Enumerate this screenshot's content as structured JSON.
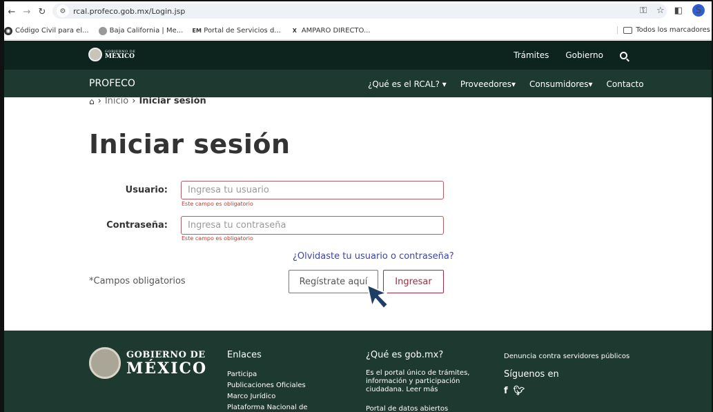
{
  "browser": {
    "url": "rcal.profeco.gob.mx/Login.jsp",
    "bookmarks": [
      "Código Civil para el...",
      "Baja California | Me...",
      "Portal de Servicios d...",
      "AMPARO DIRECTO..."
    ],
    "all_bookmarks_label": "Todos los marcadores",
    "profile_initial": "S"
  },
  "gov_header": {
    "logo_small": "GOBIERNO DE",
    "logo_large": "MÉXICO",
    "links": [
      "Trámites",
      "Gobierno"
    ]
  },
  "profeco_nav": {
    "brand": "PROFECO",
    "menu": [
      "¿Qué es el RCAL? ▾",
      "Proveedores▾",
      "Consumidores▾",
      "Contacto"
    ]
  },
  "breadcrumb": {
    "home_link": "Inicio",
    "current": "Iniciar sesión"
  },
  "page_title": "Iniciar sesión",
  "form": {
    "user_label": "Usuario:",
    "user_placeholder": "Ingresa tu usuario",
    "user_error": "Este campo es obligatorio",
    "pass_label": "Contraseña:",
    "pass_placeholder": "Ingresa tu contraseña",
    "pass_error": "Este campo es obligatorio",
    "forgot_link": "¿Olvidaste tu usuario o contraseña?",
    "required_note": "*Campos obligatorios",
    "register_button": "Regístrate aquí",
    "login_button": "Ingresar"
  },
  "footer": {
    "logo_line1": "GOBIERNO DE",
    "logo_line2": "MÉXICO",
    "links_title": "Enlaces",
    "links": [
      "Participa",
      "Publicaciones Oficiales",
      "Marco Jurídico",
      "Plataforma Nacional de"
    ],
    "about_title": "¿Qué es gob.mx?",
    "about_text": "Es el portal único de trámites, información y participación ciudadana. Leer más",
    "open_data": "Portal de datos abiertos",
    "complaint": "Denuncia contra servidores públicos",
    "follow": "Síguenos en"
  },
  "colors": {
    "gov_bar": "#0c231e",
    "nav_bar": "#1e3a30",
    "error": "#c0392b",
    "accent": "#9b2c44",
    "link": "#3c45a6"
  }
}
